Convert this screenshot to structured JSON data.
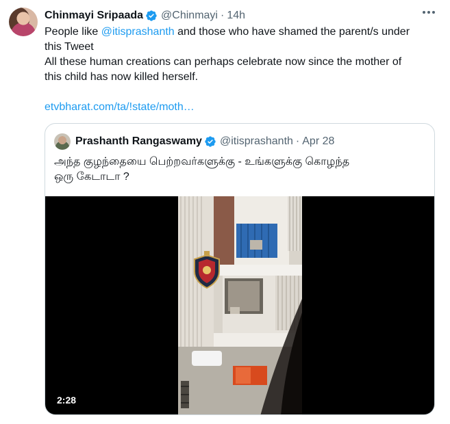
{
  "tweet": {
    "display_name": "Chinmayi Sripaada",
    "handle": "@Chinmayi",
    "separator": "·",
    "time": "14h",
    "body": {
      "line1_prefix": "People like ",
      "line1_mention": "@itisprashanth",
      "line1_suffix": " and those who have shamed the parent/s under",
      "line2": "this Tweet",
      "line3": "All these human creations can perhaps celebrate now since the mother of",
      "line4": "this child has now killed herself.",
      "link": "etvbharat.com/ta/!state/moth…"
    },
    "icons": {
      "verified": "verified-badge-icon",
      "more": "more-options-icon"
    }
  },
  "quoted": {
    "display_name": "Prashanth Rangaswamy",
    "handle": "@itisprashanth",
    "separator": "·",
    "date": "Apr 28",
    "text_line1": "அந்த குழந்தையை பெற்றவர்களுக்கு - உங்களுக்கு கொழந்த",
    "text_line2": "ஒரு கேடாடா ?",
    "video": {
      "duration": "2:28"
    }
  },
  "colors": {
    "link": "#1d9bf0",
    "verified": "#1d9bf0",
    "secondary_text": "#536471",
    "border": "#cfd9de"
  }
}
